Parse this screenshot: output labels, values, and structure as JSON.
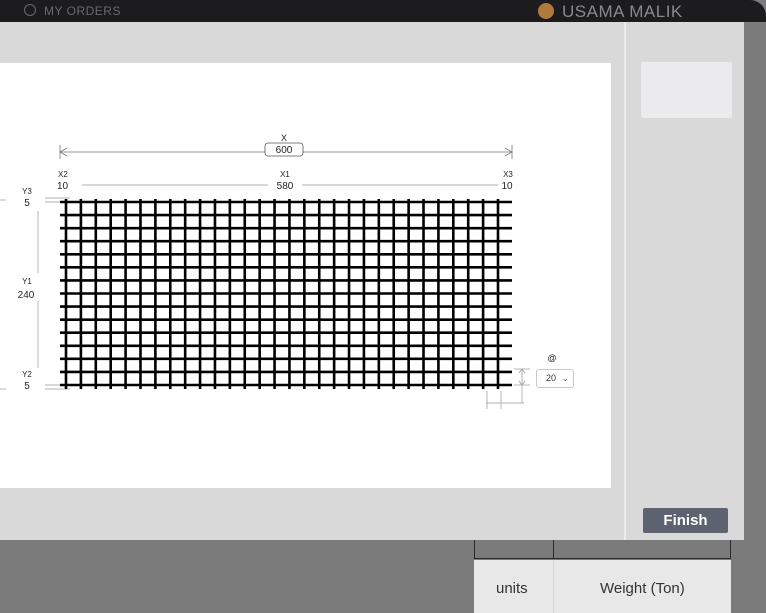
{
  "topbar": {
    "nav_orders": "MY ORDERS",
    "user_name": "USAMA MALIK"
  },
  "drawing": {
    "x_total_label": "X",
    "x_total_value": "600",
    "x1_label": "X1",
    "x1_value": "580",
    "x2_label": "X2",
    "x2_value": "10",
    "x3_label": "X3",
    "x3_value": "10",
    "y1_label": "Y1",
    "y1_value": "240",
    "y2_label": "Y2",
    "y2_value": "5",
    "y3_label": "Y3",
    "y3_value": "5",
    "spacing_label": "@",
    "spacing_value": "20"
  },
  "sidebar": {
    "finish_label": "Finish"
  },
  "table": {
    "col_units": "units",
    "col_weight": "Weight (Ton)"
  }
}
